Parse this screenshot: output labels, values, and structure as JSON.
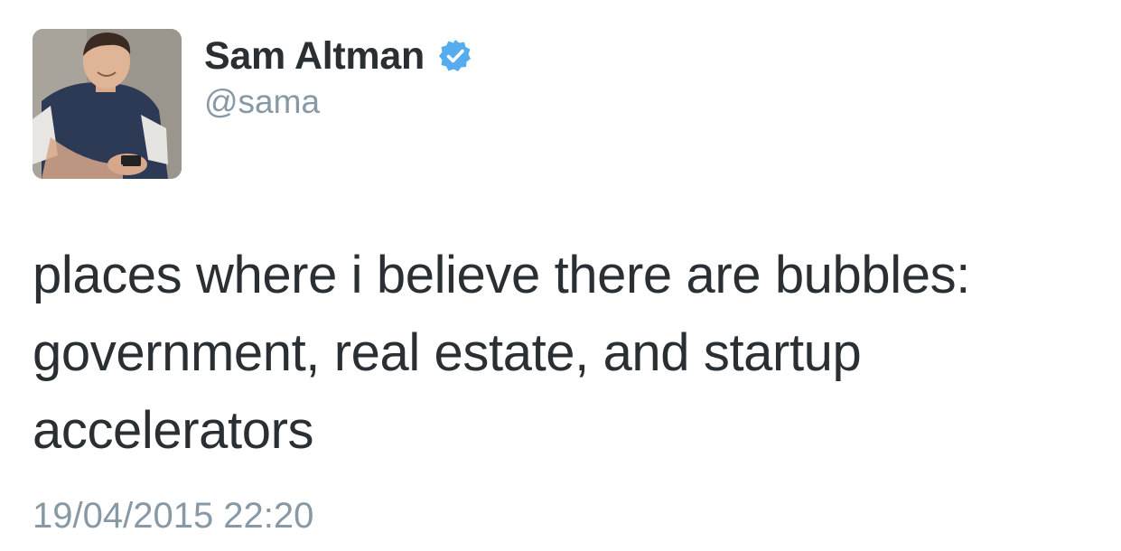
{
  "author": {
    "display_name": "Sam Altman",
    "handle": "@sama",
    "verified": true,
    "verified_color": "#55acee",
    "avatar_icon": "profile-photo"
  },
  "tweet": {
    "lines": [
      "places where i believe there are bubbles:",
      "government, real estate, and startup",
      "accelerators"
    ],
    "timestamp": "19/04/2015 22:20"
  },
  "colors": {
    "text": "#292f33",
    "secondary_text": "#8899a6"
  }
}
